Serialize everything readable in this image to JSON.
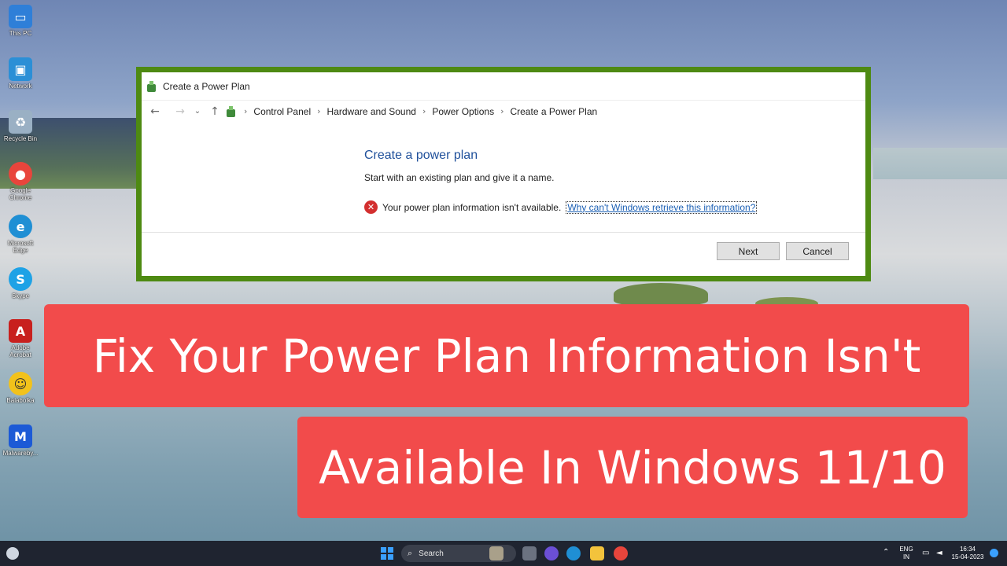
{
  "desktop": {
    "icons": [
      {
        "label": "This PC",
        "icon": "monitor-icon",
        "color": "#2f7fd8"
      },
      {
        "label": "Network",
        "icon": "network-icon",
        "color": "#2b8fd6"
      },
      {
        "label": "Recycle Bin",
        "icon": "recycle-bin-icon",
        "color": "#9ab0c4"
      },
      {
        "label": "Google Chrome",
        "icon": "chrome-icon",
        "color": "#e8453c"
      },
      {
        "label": "Microsoft Edge",
        "icon": "edge-icon",
        "color": "#1f8fd4"
      },
      {
        "label": "Skype",
        "icon": "skype-icon",
        "color": "#1ea2e6"
      },
      {
        "label": "Adobe Acrobat",
        "icon": "acrobat-icon",
        "color": "#c8201e"
      },
      {
        "label": "Balabolka",
        "icon": "balabolka-icon",
        "color": "#f2c21b"
      },
      {
        "label": "Malwareby...",
        "icon": "malwarebytes-icon",
        "color": "#1c5ad6"
      }
    ]
  },
  "dialog": {
    "title": "Create a Power Plan",
    "breadcrumbs": [
      "Control Panel",
      "Hardware and Sound",
      "Power Options",
      "Create a Power Plan"
    ],
    "heading": "Create a power plan",
    "subtext": "Start with an existing plan and give it a name.",
    "error_text": "Your power plan information isn't available.",
    "error_link": "Why can't Windows retrieve this information?",
    "next_label": "Next",
    "cancel_label": "Cancel"
  },
  "banner": {
    "line1": "Fix Your Power Plan Information Isn't",
    "line2": "Available In Windows 11/10",
    "color": "#f24b4b"
  },
  "taskbar": {
    "search_label": "Search",
    "lang_top": "ENG",
    "lang_bottom": "IN",
    "time": "16:34",
    "date": "15-04-2023"
  }
}
